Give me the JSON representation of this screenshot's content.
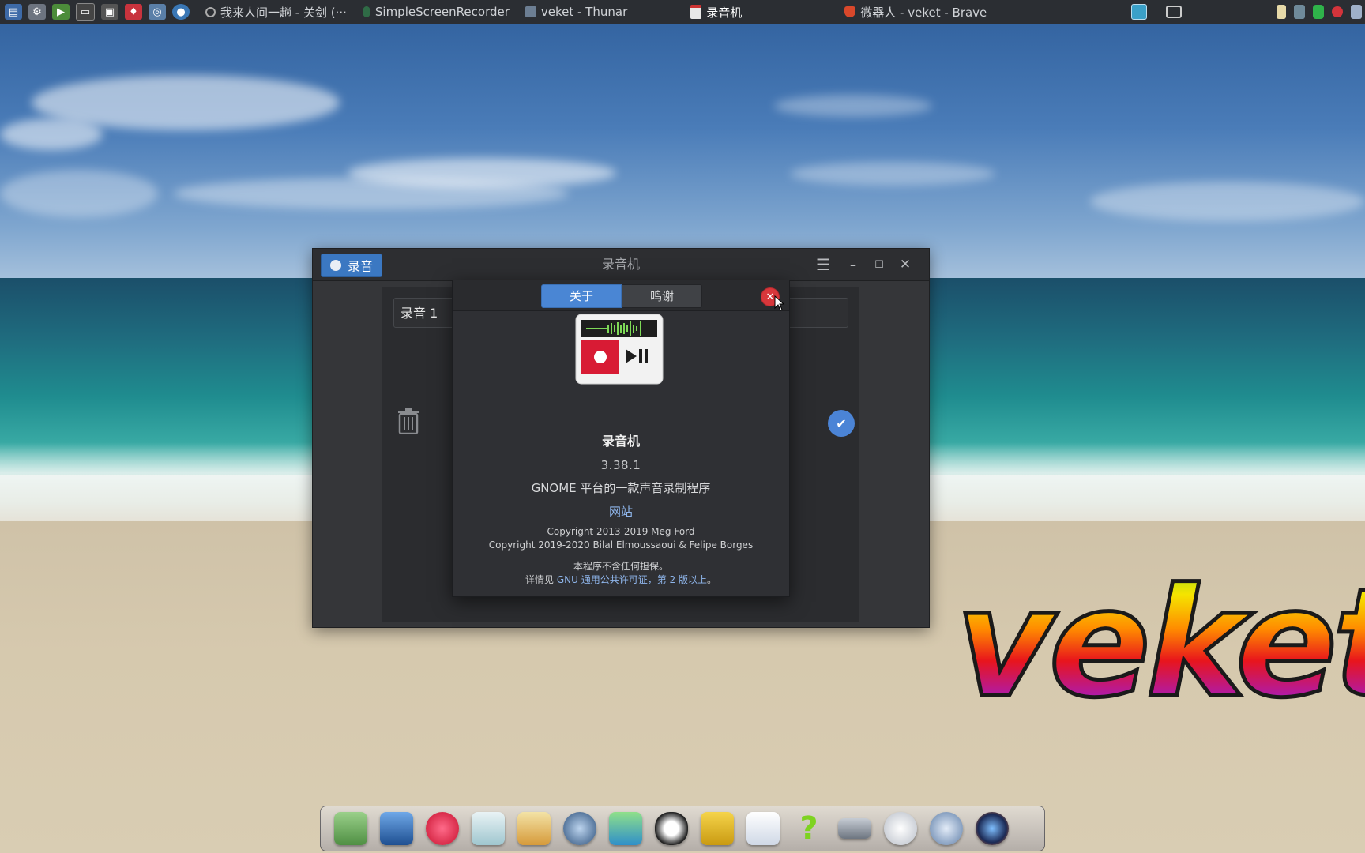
{
  "panel": {
    "tasks": [
      {
        "label": "我来人间一趟 - 关剑 (···",
        "icon": "music-icon",
        "active": false
      },
      {
        "label": "SimpleScreenRecorder",
        "icon": "screen-recorder-icon",
        "active": false
      },
      {
        "label": "veket - Thunar",
        "icon": "folder-icon",
        "active": false
      },
      {
        "label": "录音机",
        "icon": "sound-recorder-icon",
        "active": true
      },
      {
        "label": "微器人 - veket - Brave",
        "icon": "brave-icon",
        "active": false
      }
    ]
  },
  "window": {
    "title": "录音机",
    "record_label": "录音",
    "recording_name": "录音 1"
  },
  "about": {
    "tab_about": "关于",
    "tab_credits": "鸣谢",
    "app_name": "录音机",
    "version": "3.38.1",
    "description": "GNOME 平台的一款声音录制程序",
    "website": "网站",
    "copyright_1": "Copyright 2013-2019 Meg Ford",
    "copyright_2": "Copyright 2019-2020 Bilal Elmoussaoui & Felipe Borges",
    "warranty": "本程序不含任何担保。",
    "license_prefix": "详情见 ",
    "license_link": "GNU 通用公共许可证，第 2 版以上",
    "license_suffix": "。"
  },
  "desktop": {
    "logo_text": "veket"
  },
  "colors": {
    "accent": "#4a86d4",
    "close_red": "#d7373b",
    "link": "#8fb6ec"
  }
}
